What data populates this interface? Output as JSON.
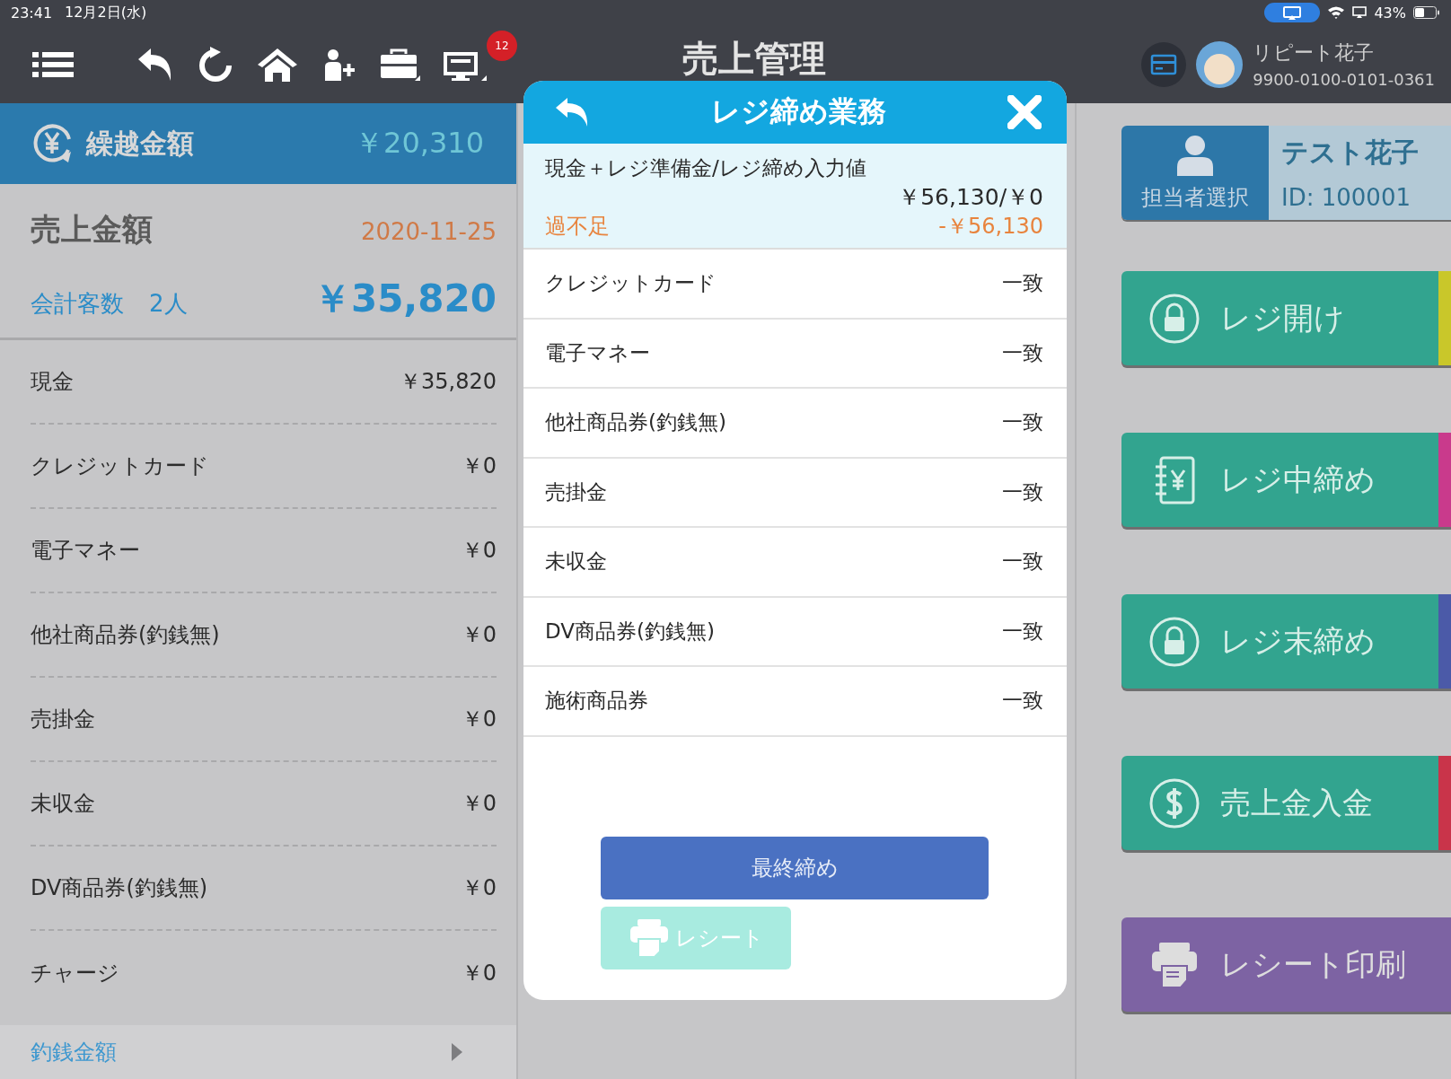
{
  "status_bar": {
    "time": "23:41",
    "date": "12月2日(水)",
    "battery": "43%"
  },
  "toolbar": {
    "title": "売上管理",
    "notification_count": "12",
    "user": {
      "name": "リピート花子",
      "number": "9900-0100-0101-0361"
    }
  },
  "carryover": {
    "label": "繰越金額",
    "amount": "￥20,310"
  },
  "sales": {
    "label": "売上金額",
    "date": "2020-11-25",
    "customers_label": "会計客数",
    "customers": "2人",
    "total": "￥35,820"
  },
  "payments": [
    {
      "name": "現金",
      "amount": "￥35,820"
    },
    {
      "name": "クレジットカード",
      "amount": "￥0"
    },
    {
      "name": "電子マネー",
      "amount": "￥0"
    },
    {
      "name": "他社商品券(釣銭無)",
      "amount": "￥0"
    },
    {
      "name": "売掛金",
      "amount": "￥0"
    },
    {
      "name": "未収金",
      "amount": "￥0"
    },
    {
      "name": "DV商品券(釣銭無)",
      "amount": "￥0"
    },
    {
      "name": "チャージ",
      "amount": "￥0"
    }
  ],
  "change_row": {
    "label": "釣銭金額"
  },
  "staff": {
    "button": "担当者選択",
    "name": "テスト花子",
    "id": "ID: 100001"
  },
  "actions": [
    {
      "label": "レジ開け",
      "kind": "lock",
      "color": "#c9c72a"
    },
    {
      "label": "レジ中締め",
      "kind": "ledger",
      "color": "#c93a8c"
    },
    {
      "label": "レジ末締め",
      "kind": "lock",
      "color": "#4b5aa8"
    },
    {
      "label": "売上金入金",
      "kind": "dollar",
      "color": "#c9344a"
    },
    {
      "label": "レシート印刷",
      "kind": "printer"
    }
  ],
  "dialog": {
    "title": "レジ締め業務",
    "summary_label": "現金＋レジ準備金/レジ締め入力値",
    "summary_value": "￥56,130/￥0",
    "diff_label": "過不足",
    "diff_value": "-￥56,130",
    "rows": [
      {
        "name": "クレジットカード",
        "status": "一致"
      },
      {
        "name": "電子マネー",
        "status": "一致"
      },
      {
        "name": "他社商品券(釣銭無)",
        "status": "一致"
      },
      {
        "name": "売掛金",
        "status": "一致"
      },
      {
        "name": "未収金",
        "status": "一致"
      },
      {
        "name": "DV商品券(釣銭無)",
        "status": "一致"
      },
      {
        "name": "施術商品券",
        "status": "一致"
      }
    ],
    "final_button": {
      "label": "最終締め",
      "disabled": false
    },
    "receipt_button": {
      "label": "レシート",
      "disabled": true
    }
  }
}
